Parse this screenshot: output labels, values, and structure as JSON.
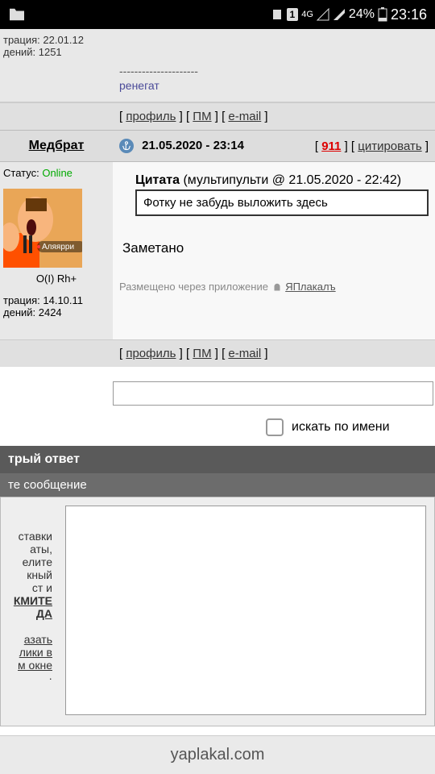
{
  "statusbar": {
    "network": "4G",
    "battery": "24%",
    "time": "23:16",
    "sim": "1"
  },
  "post1": {
    "reg_line": "трация: 22.01.12",
    "msg_line": "дений: 1251",
    "sig_divider": "---------------------",
    "sig_text": "ренегат",
    "actions": {
      "profile": "профиль",
      "pm": "ПМ",
      "email": "e-mail"
    }
  },
  "post2": {
    "username": "Медбрат",
    "datetime": "21.05.2020 - 23:14",
    "post_num": "911",
    "quote_link": "цитировать",
    "status_label": "Статус: ",
    "status_value": "Online",
    "blood": "O(I) Rh+",
    "reg_line": "трация: 14.10.11",
    "msg_line": "дений: 2424",
    "quote": {
      "title_prefix": "Цитата",
      "title_meta": " (мультипульти @ 21.05.2020 - 22:42)",
      "content": "Фотку не забудь выложить здесь"
    },
    "reply": "Заметано",
    "app_note_prefix": "Размещено через приложение ",
    "app_name": "ЯПлакалъ",
    "actions": {
      "profile": "профиль",
      "pm": "ПМ",
      "email": "e-mail"
    },
    "avatar_badge": "Аляярри"
  },
  "search": {
    "placeholder": "",
    "check_label": "искать по имени"
  },
  "quick_reply": {
    "header": "трый ответ",
    "subheader": "те сообщение",
    "hint_lines": [
      "ставки",
      "аты,",
      "елите",
      "кный",
      "ст и"
    ],
    "click_line1": "КМИТЕ",
    "click_line2": "ДА",
    "show_line1": "азать",
    "show_line2": "лики в",
    "show_line3": "м окне"
  },
  "footer": {
    "domain": "yaplakal.com"
  }
}
